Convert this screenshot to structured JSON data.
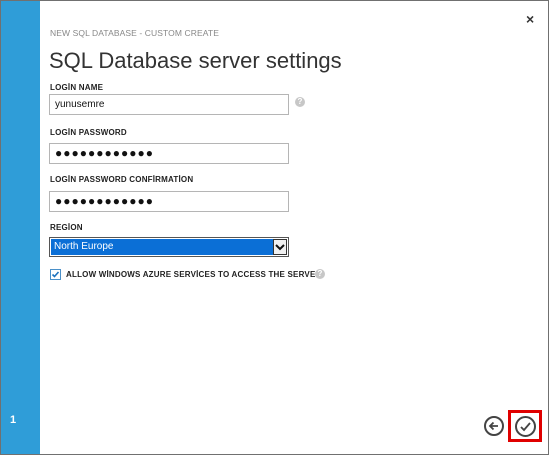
{
  "wizard": {
    "step_number": "1",
    "subtitle": "NEW SQL DATABASE - CUSTOM CREATE",
    "title": "SQL Database server settings"
  },
  "form": {
    "login_name_label": "LOGİN NAME",
    "login_name_value": "yunusemre",
    "login_password_label": "LOGİN PASSWORD",
    "login_password_value": "●●●●●●●●●●●●",
    "confirm_password_label": "LOGİN PASSWORD CONFİRMATİON",
    "confirm_password_value": "●●●●●●●●●●●●",
    "region_label": "REGİON",
    "region_value": "North Europe",
    "allow_azure_label": "ALLOW WİNDOWS AZURE SERVİCES TO ACCESS THE SERVER",
    "allow_azure_checked": true
  },
  "icons": {
    "help": "question-icon",
    "close": "close-icon",
    "back": "back-arrow-icon",
    "complete": "checkmark-icon"
  },
  "colors": {
    "step_bar": "#2f9dd8",
    "selected_option": "#0b6fd6",
    "highlight_border": "#e00000"
  }
}
